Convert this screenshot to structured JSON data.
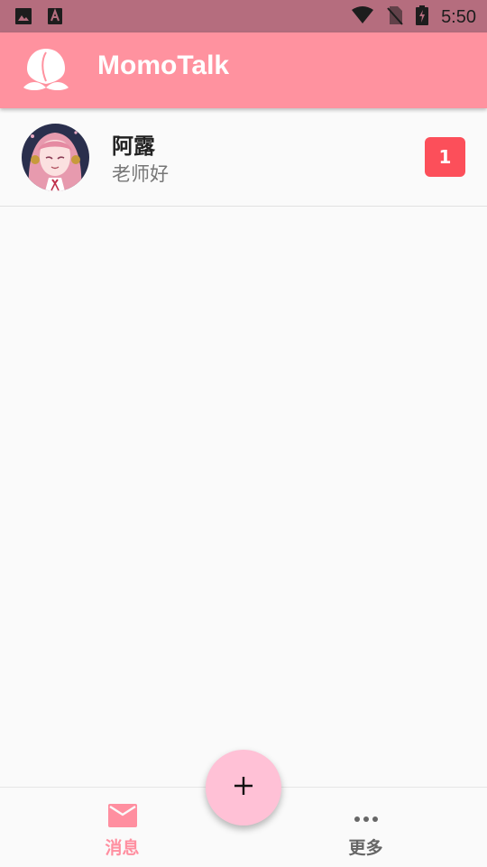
{
  "status_bar": {
    "time": "5:50",
    "left_icons": [
      "image-icon",
      "font-download-icon"
    ],
    "right_icons": [
      "wifi-icon",
      "no-sim-icon",
      "battery-charging-icon"
    ]
  },
  "app_bar": {
    "title": "MomoTalk",
    "logo_icon": "peach-icon",
    "color": "#ff929f"
  },
  "chats": [
    {
      "name": "阿露",
      "preview": "老师好",
      "unread": "1",
      "avatar": "avatar-aru"
    }
  ],
  "fab": {
    "icon": "plus-icon",
    "color": "#ffc1d6"
  },
  "bottom_nav": [
    {
      "label": "消息",
      "icon": "mail-icon",
      "active": true,
      "color": "#ff8fa0"
    },
    {
      "label": "更多",
      "icon": "more-horizontal-icon",
      "active": false
    }
  ],
  "colors": {
    "badge": "#fc4f5a",
    "status_bar": "#b56d7e"
  }
}
